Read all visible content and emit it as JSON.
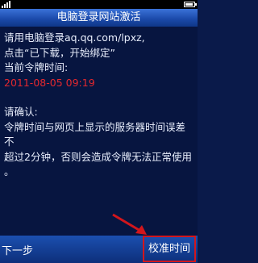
{
  "status_bar": {
    "signal_icon": "signal-icon",
    "battery_icon": "battery-icon"
  },
  "title": "电脑登录网站激活",
  "content": {
    "line1": "请用电脑登录aq.qq.com/lpxz,",
    "line2": "点击“已下载，开始绑定”",
    "line3": "当前令牌时间:",
    "token_time": "2011-08-05 09:19",
    "confirm_heading": "请确认:",
    "confirm_line1": "令牌时间与网页上显示的服务器时间误差不",
    "confirm_line2": "超过2分钟，否则会造成令牌无法正常使用",
    "confirm_line3": "。"
  },
  "colors": {
    "token_time": "#e3282e",
    "highlight_box": "#d2161c",
    "arrow": "#d2161c"
  },
  "softkeys": {
    "left_label": "下一步",
    "right_label": "校准时间"
  }
}
